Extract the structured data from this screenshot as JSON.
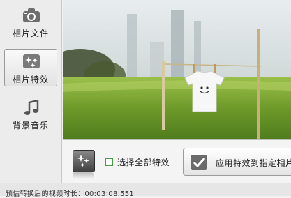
{
  "sidebar": {
    "items": [
      {
        "label": "相片文件",
        "icon": "camera-icon"
      },
      {
        "label": "相片特效",
        "icon": "sparkle-effects-icon"
      },
      {
        "label": "背景音乐",
        "icon": "music-note-icon"
      }
    ],
    "active_index": 1
  },
  "preview": {
    "subject": "photo"
  },
  "toolbar": {
    "effect_icon": "effects-thumbnail-icon",
    "select_all_label": "选择全部特效",
    "select_all_checked": false,
    "apply_label": "应用特效到指定相片"
  },
  "status": {
    "prefix": "预估转换后的视频时长：",
    "duration": "00:03:08.551"
  },
  "colors": {
    "accent_green": "#4a9a4a",
    "sidebar_bg": "#ececec"
  }
}
